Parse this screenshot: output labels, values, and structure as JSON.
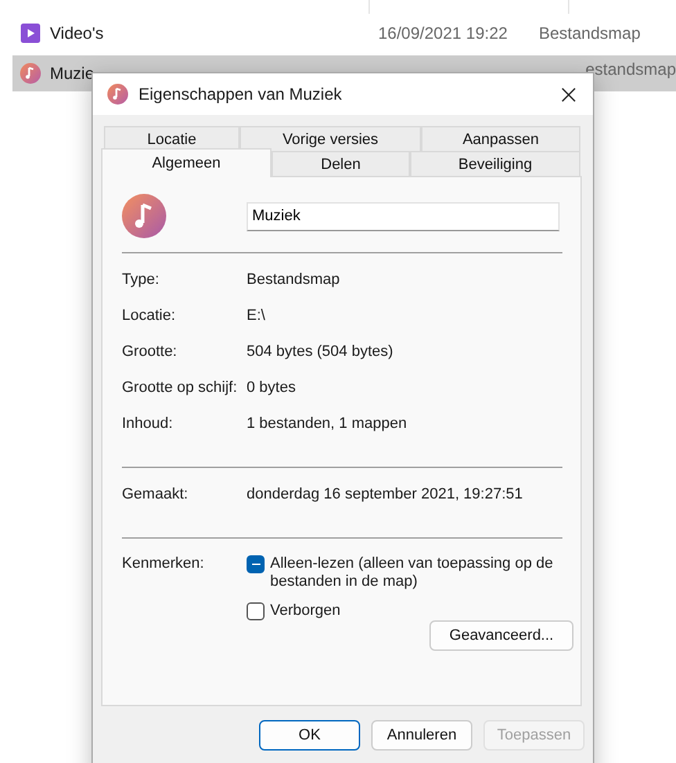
{
  "explorer": {
    "rows": [
      {
        "kind": "video",
        "name": "Video's",
        "date": "16/09/2021 19:22",
        "type": "Bestandsmap",
        "selected": false
      },
      {
        "kind": "music",
        "name": "Muzie",
        "type": "estandsmap",
        "selected": true
      }
    ]
  },
  "dialog": {
    "title": "Eigenschappen van Muziek",
    "tab_rows": [
      [
        {
          "label": "Locatie",
          "selected": false
        },
        {
          "label": "Vorige versies",
          "selected": false
        },
        {
          "label": "Aanpassen",
          "selected": false
        }
      ],
      [
        {
          "label": "Algemeen",
          "selected": true
        },
        {
          "label": "Delen",
          "selected": false
        },
        {
          "label": "Beveiliging",
          "selected": false
        }
      ]
    ],
    "name_value": "Muziek",
    "groups": [
      [
        {
          "label": "Type:",
          "value": "Bestandsmap"
        },
        {
          "label": "Locatie:",
          "value": "E:\\"
        },
        {
          "label": "Grootte:",
          "value": "504 bytes (504 bytes)"
        },
        {
          "label": "Grootte op schijf:",
          "value": "0 bytes"
        },
        {
          "label": "Inhoud:",
          "value": "1 bestanden, 1 mappen"
        }
      ],
      [
        {
          "label": "Gemaakt:",
          "value": "donderdag 16 september 2021, 19:27:51"
        }
      ]
    ],
    "attributes": {
      "label": "Kenmerken:",
      "options": [
        {
          "label": "Alleen-lezen (alleen van toepassing op de bestanden in de map)",
          "checked": true,
          "indeterminate": true
        },
        {
          "label": "Verborgen",
          "checked": false,
          "indeterminate": false
        }
      ],
      "advanced_button": "Geavanceerd..."
    },
    "buttons": [
      {
        "label": "OK",
        "default": true,
        "disabled": false
      },
      {
        "label": "Annuleren",
        "default": false,
        "disabled": false
      },
      {
        "label": "Toepassen",
        "default": false,
        "disabled": true
      }
    ]
  }
}
